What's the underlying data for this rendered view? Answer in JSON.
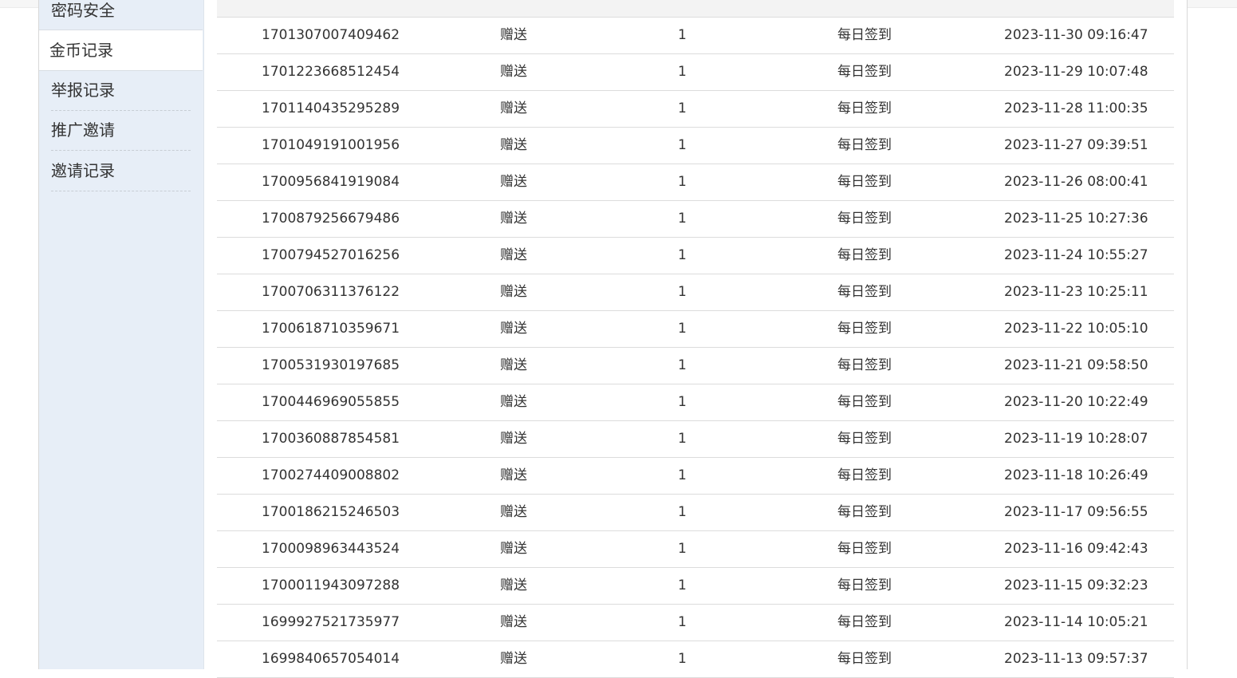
{
  "sidebar": {
    "items": [
      {
        "label": "密码安全"
      },
      {
        "label": "金币记录",
        "active": true
      },
      {
        "label": "举报记录"
      },
      {
        "label": "推广邀请"
      },
      {
        "label": "邀请记录"
      }
    ]
  },
  "records": [
    {
      "id": "1701307007409462",
      "type": "赠送",
      "amount": "1",
      "source": "每日签到",
      "time": "2023-11-30 09:16:47"
    },
    {
      "id": "1701223668512454",
      "type": "赠送",
      "amount": "1",
      "source": "每日签到",
      "time": "2023-11-29 10:07:48"
    },
    {
      "id": "1701140435295289",
      "type": "赠送",
      "amount": "1",
      "source": "每日签到",
      "time": "2023-11-28 11:00:35"
    },
    {
      "id": "1701049191001956",
      "type": "赠送",
      "amount": "1",
      "source": "每日签到",
      "time": "2023-11-27 09:39:51"
    },
    {
      "id": "1700956841919084",
      "type": "赠送",
      "amount": "1",
      "source": "每日签到",
      "time": "2023-11-26 08:00:41"
    },
    {
      "id": "1700879256679486",
      "type": "赠送",
      "amount": "1",
      "source": "每日签到",
      "time": "2023-11-25 10:27:36"
    },
    {
      "id": "1700794527016256",
      "type": "赠送",
      "amount": "1",
      "source": "每日签到",
      "time": "2023-11-24 10:55:27"
    },
    {
      "id": "1700706311376122",
      "type": "赠送",
      "amount": "1",
      "source": "每日签到",
      "time": "2023-11-23 10:25:11"
    },
    {
      "id": "1700618710359671",
      "type": "赠送",
      "amount": "1",
      "source": "每日签到",
      "time": "2023-11-22 10:05:10"
    },
    {
      "id": "1700531930197685",
      "type": "赠送",
      "amount": "1",
      "source": "每日签到",
      "time": "2023-11-21 09:58:50"
    },
    {
      "id": "1700446969055855",
      "type": "赠送",
      "amount": "1",
      "source": "每日签到",
      "time": "2023-11-20 10:22:49"
    },
    {
      "id": "1700360887854581",
      "type": "赠送",
      "amount": "1",
      "source": "每日签到",
      "time": "2023-11-19 10:28:07"
    },
    {
      "id": "1700274409008802",
      "type": "赠送",
      "amount": "1",
      "source": "每日签到",
      "time": "2023-11-18 10:26:49"
    },
    {
      "id": "1700186215246503",
      "type": "赠送",
      "amount": "1",
      "source": "每日签到",
      "time": "2023-11-17 09:56:55"
    },
    {
      "id": "1700098963443524",
      "type": "赠送",
      "amount": "1",
      "source": "每日签到",
      "time": "2023-11-16 09:42:43"
    },
    {
      "id": "1700011943097288",
      "type": "赠送",
      "amount": "1",
      "source": "每日签到",
      "time": "2023-11-15 09:32:23"
    },
    {
      "id": "1699927521735977",
      "type": "赠送",
      "amount": "1",
      "source": "每日签到",
      "time": "2023-11-14 10:05:21"
    },
    {
      "id": "1699840657054014",
      "type": "赠送",
      "amount": "1",
      "source": "每日签到",
      "time": "2023-11-13 09:57:37"
    }
  ]
}
